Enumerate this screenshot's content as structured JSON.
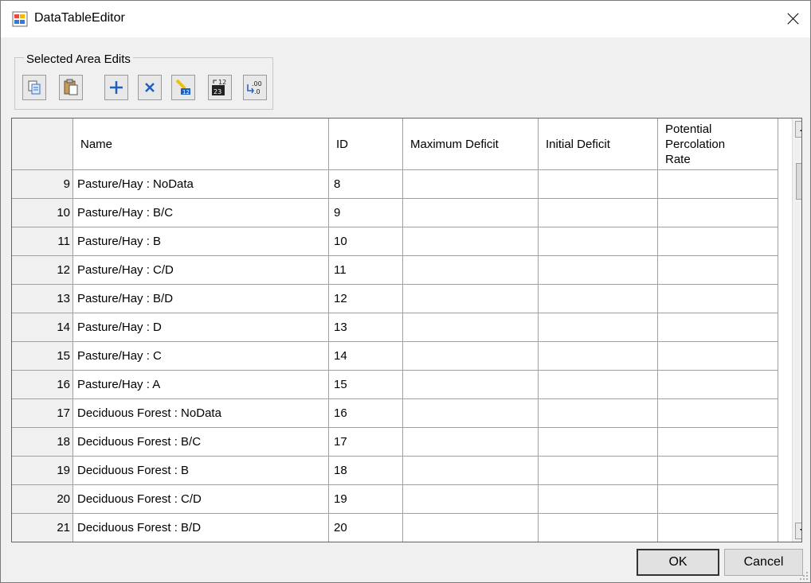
{
  "window": {
    "title": "DataTableEditor"
  },
  "toolbar": {
    "group_label": "Selected Area Edits",
    "buttons": [
      {
        "name": "copy-button",
        "icon": "copy-icon"
      },
      {
        "name": "paste-button",
        "icon": "paste-icon"
      },
      {
        "name": "add-button",
        "icon": "plus-icon"
      },
      {
        "name": "delete-button",
        "icon": "delete-x-icon"
      },
      {
        "name": "fill-button",
        "icon": "fill-series-icon"
      },
      {
        "name": "renumber-button",
        "icon": "numbering-icon"
      },
      {
        "name": "decimal-button",
        "icon": "decimal-format-icon"
      }
    ]
  },
  "grid": {
    "columns": [
      "Name",
      "ID",
      "Maximum Deficit",
      "Initial Deficit",
      "Potential Percolation Rate"
    ],
    "rows": [
      {
        "num": "9",
        "name": "Pasture/Hay : NoData",
        "id": "8",
        "max": "",
        "init": "",
        "perc": ""
      },
      {
        "num": "10",
        "name": "Pasture/Hay : B/C",
        "id": "9",
        "max": "",
        "init": "",
        "perc": ""
      },
      {
        "num": "11",
        "name": "Pasture/Hay : B",
        "id": "10",
        "max": "",
        "init": "",
        "perc": ""
      },
      {
        "num": "12",
        "name": "Pasture/Hay : C/D",
        "id": "11",
        "max": "",
        "init": "",
        "perc": ""
      },
      {
        "num": "13",
        "name": "Pasture/Hay : B/D",
        "id": "12",
        "max": "",
        "init": "",
        "perc": ""
      },
      {
        "num": "14",
        "name": "Pasture/Hay : D",
        "id": "13",
        "max": "",
        "init": "",
        "perc": ""
      },
      {
        "num": "15",
        "name": "Pasture/Hay : C",
        "id": "14",
        "max": "",
        "init": "",
        "perc": ""
      },
      {
        "num": "16",
        "name": "Pasture/Hay : A",
        "id": "15",
        "max": "",
        "init": "",
        "perc": ""
      },
      {
        "num": "17",
        "name": "Deciduous Forest : NoData",
        "id": "16",
        "max": "",
        "init": "",
        "perc": ""
      },
      {
        "num": "18",
        "name": "Deciduous Forest : B/C",
        "id": "17",
        "max": "",
        "init": "",
        "perc": ""
      },
      {
        "num": "19",
        "name": "Deciduous Forest : B",
        "id": "18",
        "max": "",
        "init": "",
        "perc": ""
      },
      {
        "num": "20",
        "name": "Deciduous Forest : C/D",
        "id": "19",
        "max": "",
        "init": "",
        "perc": ""
      },
      {
        "num": "21",
        "name": "Deciduous Forest : B/D",
        "id": "20",
        "max": "",
        "init": "",
        "perc": ""
      }
    ]
  },
  "buttons": {
    "ok": "OK",
    "cancel": "Cancel"
  }
}
